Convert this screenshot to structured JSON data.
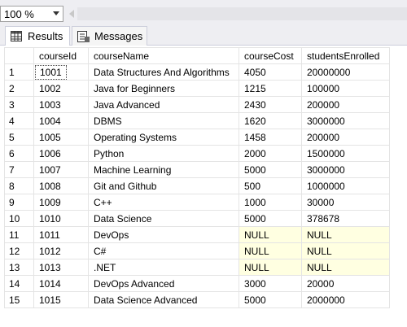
{
  "toolbar": {
    "zoom_value": "100 %"
  },
  "tabs": {
    "results": "Results",
    "messages": "Messages"
  },
  "grid": {
    "columns": [
      "",
      "courseId",
      "courseName",
      "courseCost",
      "studentsEnrolled"
    ],
    "rows": [
      [
        "1",
        "1001",
        "Data Structures And Algorithms",
        "4050",
        "20000000"
      ],
      [
        "2",
        "1002",
        "Java for Beginners",
        "1215",
        "100000"
      ],
      [
        "3",
        "1003",
        "Java Advanced",
        "2430",
        "200000"
      ],
      [
        "4",
        "1004",
        "DBMS",
        "1620",
        "3000000"
      ],
      [
        "5",
        "1005",
        "Operating Systems",
        "1458",
        "200000"
      ],
      [
        "6",
        "1006",
        "Python",
        "2000",
        "1500000"
      ],
      [
        "7",
        "1007",
        "Machine Learning",
        "5000",
        "3000000"
      ],
      [
        "8",
        "1008",
        "Git and Github",
        "500",
        "1000000"
      ],
      [
        "9",
        "1009",
        "C++",
        "1000",
        "30000"
      ],
      [
        "10",
        "1010",
        "Data Science",
        "5000",
        "378678"
      ],
      [
        "11",
        "1011",
        "DevOps",
        "NULL",
        "NULL"
      ],
      [
        "12",
        "1012",
        "C#",
        "NULL",
        "NULL"
      ],
      [
        "13",
        "1013",
        ".NET",
        "NULL",
        "NULL"
      ],
      [
        "14",
        "1014",
        "DevOps Advanced",
        "3000",
        "20000"
      ],
      [
        "15",
        "1015",
        "Data Science Advanced",
        "5000",
        "2000000"
      ]
    ]
  },
  "colors": {
    "null_cell": "#ffffe1",
    "chrome": "#eeeef2",
    "border": "#e4e4e4"
  },
  "icons": {
    "results_tab": "grid-icon",
    "messages_tab": "messages-icon"
  }
}
